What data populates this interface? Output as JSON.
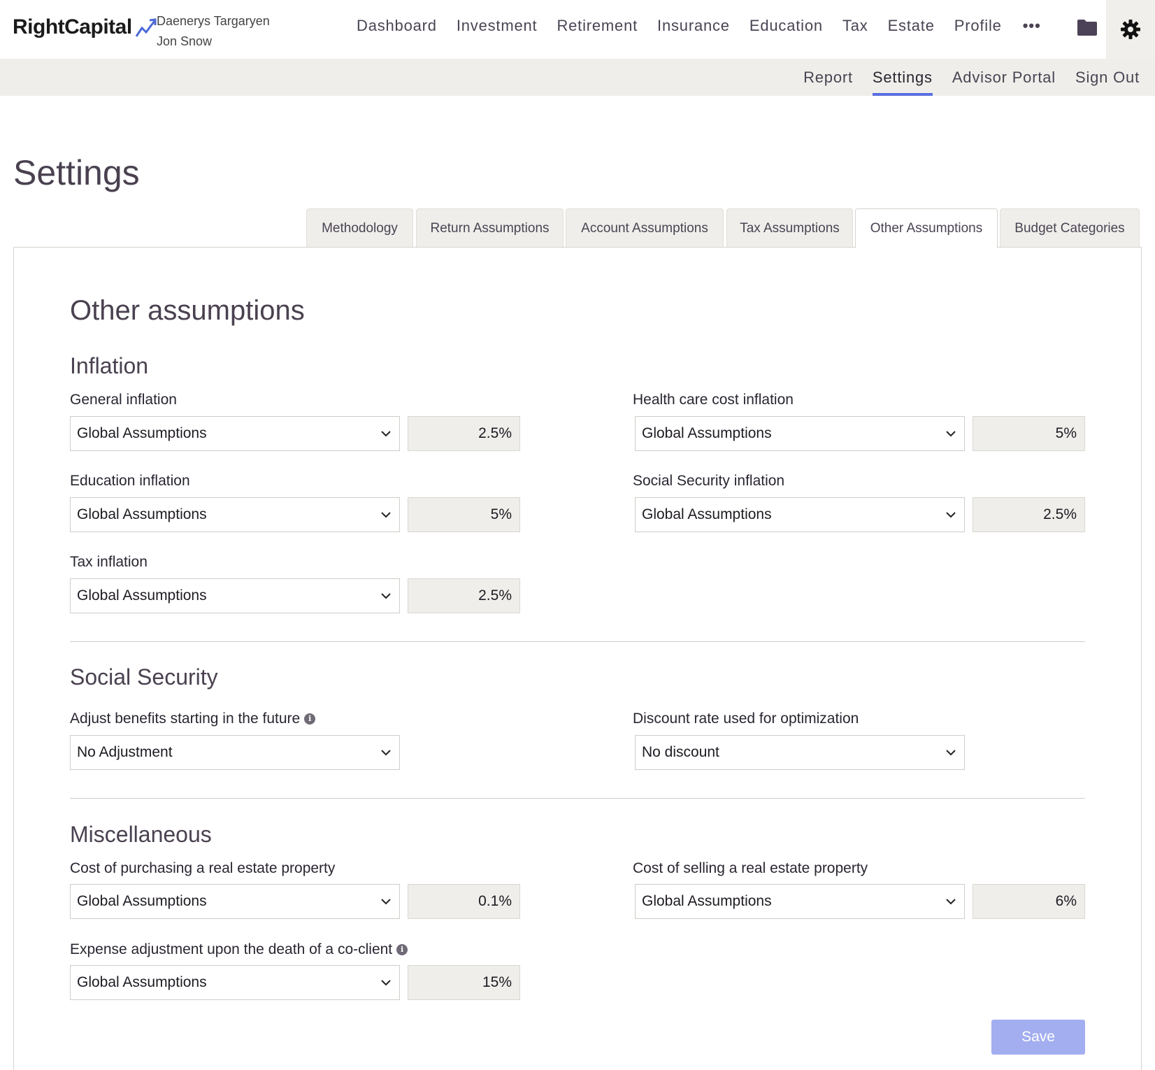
{
  "header": {
    "logo_text": "RightCapital",
    "clients": [
      "Daenerys Targaryen",
      "Jon Snow"
    ],
    "nav": [
      "Dashboard",
      "Investment",
      "Retirement",
      "Insurance",
      "Education",
      "Tax",
      "Estate",
      "Profile"
    ],
    "more_label": "•••",
    "icons": [
      "folder-icon",
      "gear-icon"
    ]
  },
  "subnav": {
    "items": [
      "Report",
      "Settings",
      "Advisor Portal",
      "Sign Out"
    ],
    "active": "Settings"
  },
  "page": {
    "title": "Settings"
  },
  "tabs": {
    "items": [
      "Methodology",
      "Return Assumptions",
      "Account Assumptions",
      "Tax Assumptions",
      "Other Assumptions",
      "Budget Categories"
    ],
    "active": "Other Assumptions"
  },
  "content": {
    "heading": "Other assumptions",
    "inflation": {
      "title": "Inflation",
      "general": {
        "label": "General inflation",
        "select": "Global Assumptions",
        "value": "2.5%"
      },
      "health": {
        "label": "Health care cost inflation",
        "select": "Global Assumptions",
        "value": "5%"
      },
      "education": {
        "label": "Education inflation",
        "select": "Global Assumptions",
        "value": "5%"
      },
      "social_security": {
        "label": "Social Security inflation",
        "select": "Global Assumptions",
        "value": "2.5%"
      },
      "tax": {
        "label": "Tax inflation",
        "select": "Global Assumptions",
        "value": "2.5%"
      }
    },
    "social_security": {
      "title": "Social Security",
      "adjust": {
        "label": "Adjust benefits starting in the future",
        "select": "No Adjustment"
      },
      "discount": {
        "label": "Discount rate used for optimization",
        "select": "No discount"
      }
    },
    "misc": {
      "title": "Miscellaneous",
      "purchase": {
        "label": "Cost of purchasing a real estate property",
        "select": "Global Assumptions",
        "value": "0.1%"
      },
      "selling": {
        "label": "Cost of selling a real estate property",
        "select": "Global Assumptions",
        "value": "6%"
      },
      "death": {
        "label": "Expense adjustment upon the death of a co-client",
        "select": "Global Assumptions",
        "value": "15%"
      }
    },
    "save_label": "Save"
  },
  "colors": {
    "accent": "#5a6ee0",
    "save_button": "#a3aef0",
    "heading": "#4a4150"
  }
}
